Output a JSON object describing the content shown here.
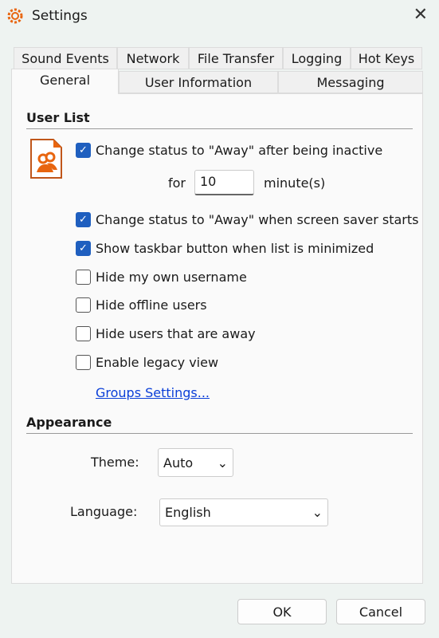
{
  "window": {
    "title": "Settings"
  },
  "tabs_row1": [
    "Sound Events",
    "Network",
    "File Transfer",
    "Logging",
    "Hot Keys"
  ],
  "tabs_row2": [
    "General",
    "User Information",
    "Messaging"
  ],
  "user_list": {
    "heading": "User List",
    "away_inactive": {
      "label": "Change status to \"Away\" after being inactive",
      "checked": true
    },
    "for_label": "for",
    "minutes_value": "10",
    "minutes_unit": "minute(s)",
    "options": [
      {
        "label": "Change status to \"Away\" when screen saver starts",
        "checked": true
      },
      {
        "label": "Show taskbar button when list is minimized",
        "checked": true
      },
      {
        "label": "Hide my own username",
        "checked": false
      },
      {
        "label": "Hide offline users",
        "checked": false
      },
      {
        "label": "Hide users that are away",
        "checked": false
      },
      {
        "label": "Enable legacy view",
        "checked": false
      }
    ],
    "groups_link": "Groups Settings..."
  },
  "appearance": {
    "heading": "Appearance",
    "theme_label": "Theme:",
    "theme_value": "Auto",
    "language_label": "Language:",
    "language_value": "English"
  },
  "buttons": {
    "ok": "OK",
    "cancel": "Cancel"
  },
  "colors": {
    "accent": "#1f5fbf",
    "icon": "#e8650f"
  }
}
